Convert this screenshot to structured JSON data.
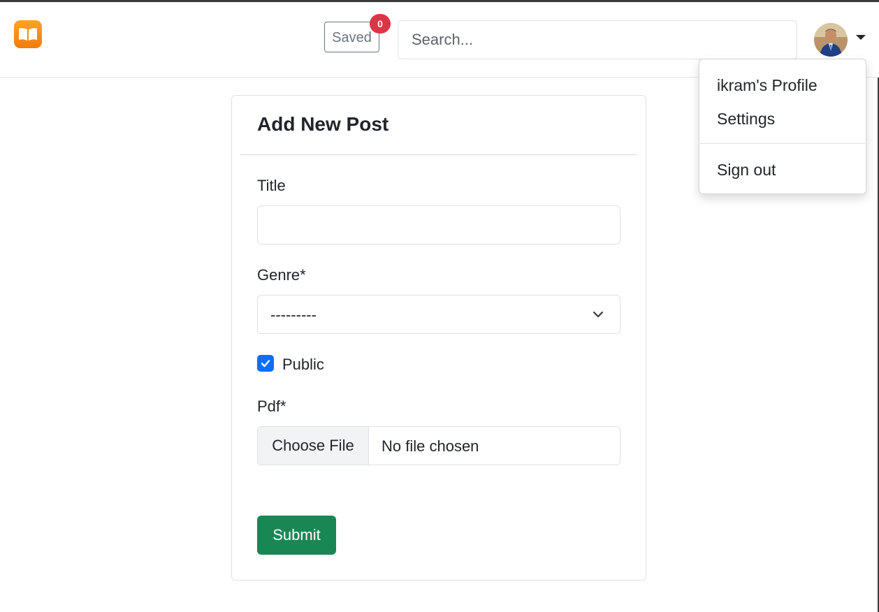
{
  "header": {
    "saved_label": "Saved",
    "saved_count": "0",
    "search": {
      "placeholder": "Search...",
      "value": ""
    },
    "menu": {
      "items": [
        "ikram's Profile",
        "Settings"
      ],
      "signout": "Sign out"
    }
  },
  "form": {
    "heading": "Add New Post",
    "title_label": "Title",
    "title_value": "",
    "genre_label": "Genre*",
    "genre_selected": "---------",
    "public_label": "Public",
    "public_checked": true,
    "pdf_label": "Pdf*",
    "file_button": "Choose File",
    "file_status": "No file chosen",
    "submit_label": "Submit"
  },
  "colors": {
    "accent": "#0d6efd",
    "success": "#198754",
    "danger": "#dc3545",
    "logo": "#f7890f"
  },
  "icons": {
    "logo": "open-book-icon",
    "select": "chevron-down-icon",
    "checkbox": "checkmark-icon",
    "menu": "caret-down-icon"
  }
}
